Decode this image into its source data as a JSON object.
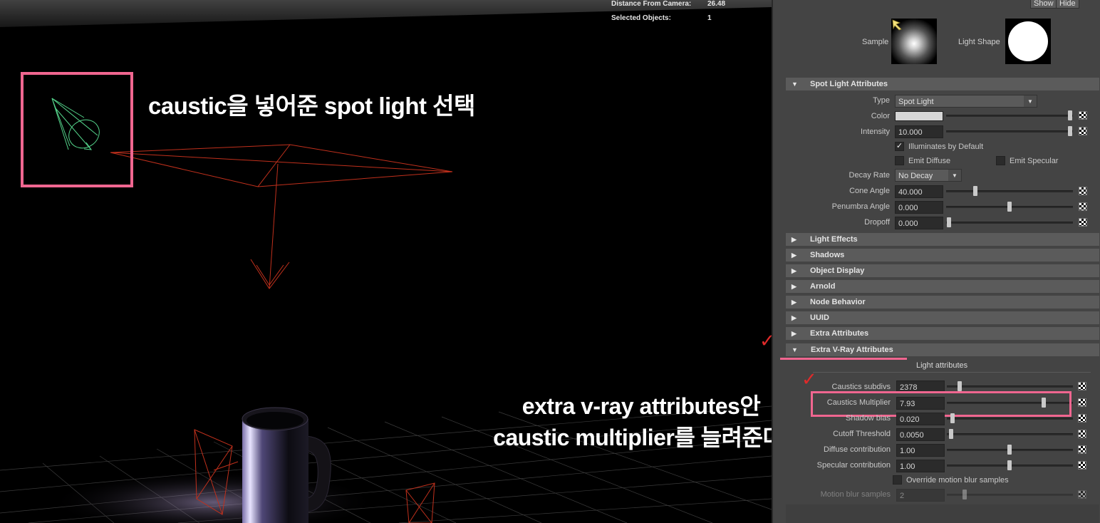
{
  "hud": {
    "distance_label": "Distance From Camera:",
    "distance_value": "26.48",
    "selected_label": "Selected Objects:",
    "selected_value": "1"
  },
  "annotations": {
    "top_note": "caustic을 넣어준 spot light 선택",
    "bottom_note_line1": "extra v-ray attributes안",
    "bottom_note_line2": "caustic multiplier를 늘려준다.",
    "highlight_color": "#f06690",
    "checkmark_color": "#e02a2a",
    "checkmark_glyph": "✓"
  },
  "panel": {
    "show_label": "Show",
    "hide_label": "Hide",
    "sample_label": "Sample",
    "light_shape_label": "Light Shape",
    "spot_section": {
      "title": "Spot Light Attributes",
      "type_label": "Type",
      "type_value": "Spot Light",
      "color_label": "Color",
      "color_value": "#d6d6d6",
      "intensity_label": "Intensity",
      "intensity_value": "10.000",
      "illuminates_label": "Illuminates by Default",
      "illuminates_checked": true,
      "emit_diffuse_label": "Emit Diffuse",
      "emit_specular_label": "Emit Specular",
      "decay_label": "Decay Rate",
      "decay_value": "No Decay",
      "cone_label": "Cone Angle",
      "cone_value": "40.000",
      "penumbra_label": "Penumbra Angle",
      "penumbra_value": "0.000",
      "dropoff_label": "Dropoff",
      "dropoff_value": "0.000"
    },
    "collapsed_sections": [
      "Light Effects",
      "Shadows",
      "Object Display",
      "Arnold",
      "Node Behavior",
      "UUID",
      "Extra Attributes"
    ],
    "vray_section": {
      "title": "Extra V-Ray Attributes",
      "subheading": "Light attributes",
      "caustics_subdivs_label": "Caustics subdivs",
      "caustics_subdivs_value": "2378",
      "caustics_multiplier_label": "Caustics Multiplier",
      "caustics_multiplier_value": "7.93",
      "shadow_bias_label": "Shadow bias",
      "shadow_bias_value": "0.020",
      "cutoff_label": "Cutoff Threshold",
      "cutoff_value": "0.0050",
      "diffuse_label": "Diffuse contribution",
      "diffuse_value": "1.00",
      "specular_label": "Specular contribution",
      "specular_value": "1.00",
      "override_label": "Override motion blur samples",
      "motion_label": "Motion blur samples",
      "motion_value": "2"
    }
  }
}
